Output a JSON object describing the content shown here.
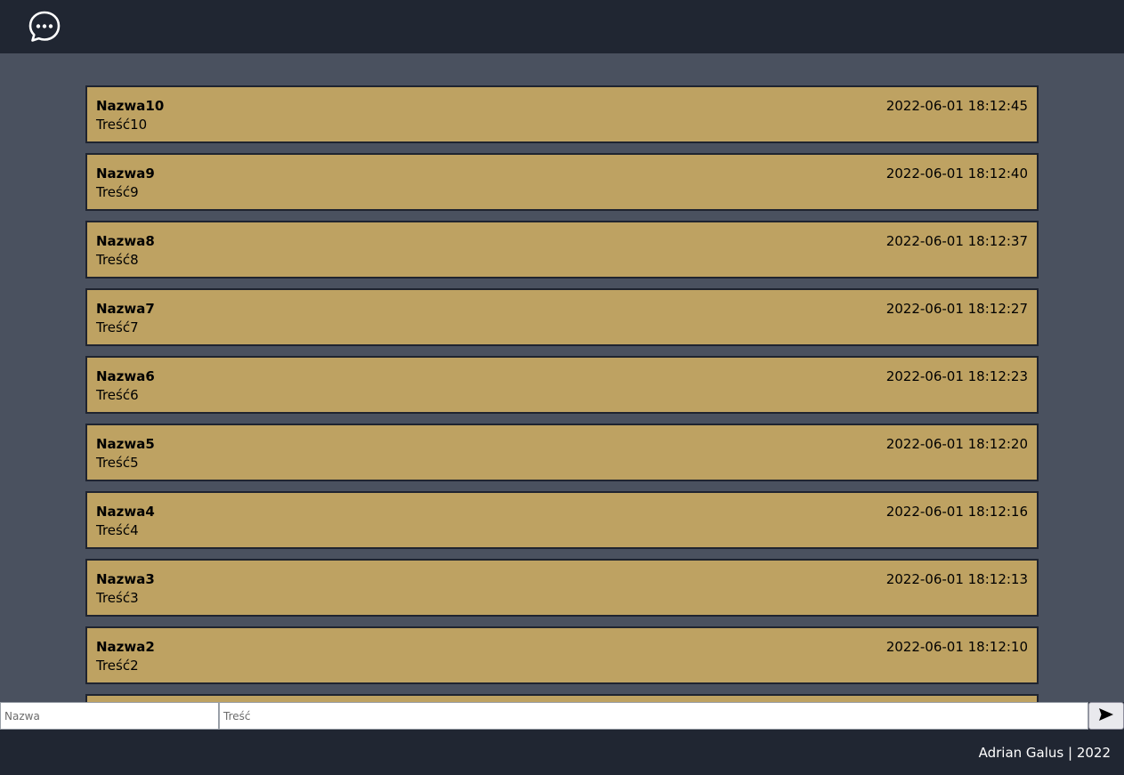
{
  "header": {
    "logo_icon": "chat-bubble-icon"
  },
  "messages": [
    {
      "name": "Nazwa10",
      "body": "Treść10",
      "date": "2022-06-01 18:12:45"
    },
    {
      "name": "Nazwa9",
      "body": "Treść9",
      "date": "2022-06-01 18:12:40"
    },
    {
      "name": "Nazwa8",
      "body": "Treść8",
      "date": "2022-06-01 18:12:37"
    },
    {
      "name": "Nazwa7",
      "body": "Treść7",
      "date": "2022-06-01 18:12:27"
    },
    {
      "name": "Nazwa6",
      "body": "Treść6",
      "date": "2022-06-01 18:12:23"
    },
    {
      "name": "Nazwa5",
      "body": "Treść5",
      "date": "2022-06-01 18:12:20"
    },
    {
      "name": "Nazwa4",
      "body": "Treść4",
      "date": "2022-06-01 18:12:16"
    },
    {
      "name": "Nazwa3",
      "body": "Treść3",
      "date": "2022-06-01 18:12:13"
    },
    {
      "name": "Nazwa2",
      "body": "Treść2",
      "date": "2022-06-01 18:12:10"
    }
  ],
  "composer": {
    "name_placeholder": "Nazwa",
    "name_value": "",
    "body_placeholder": "Treść",
    "body_value": "",
    "send_icon": "send-arrow-icon"
  },
  "footer": {
    "text": "Adrian Galus | 2022"
  },
  "colors": {
    "header_bg": "#202632",
    "page_bg": "#4a515f",
    "message_bg": "#bea262",
    "message_border": "#1f2430"
  }
}
